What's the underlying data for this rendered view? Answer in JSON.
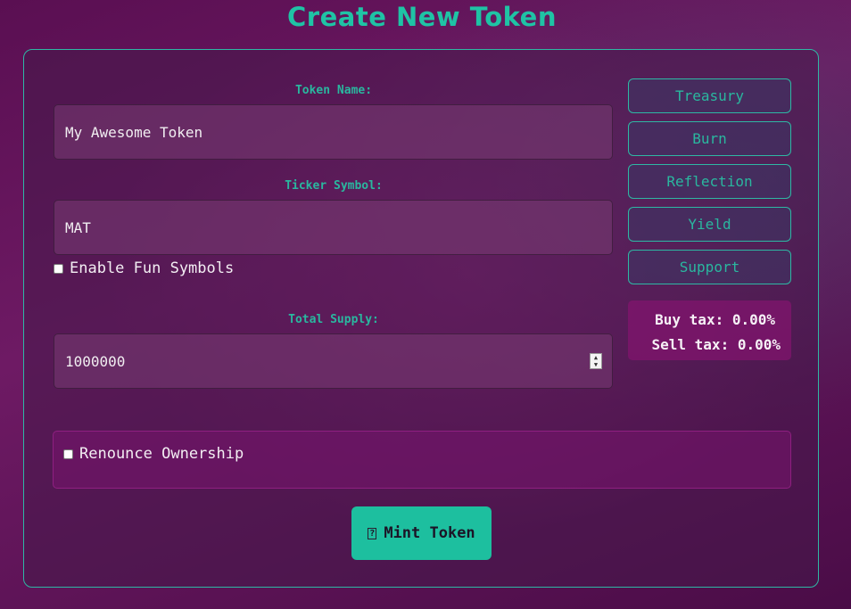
{
  "page": {
    "title": "Create New Token"
  },
  "form": {
    "token_name": {
      "label": "Token Name:",
      "value": "My Awesome Token"
    },
    "ticker": {
      "label": "Ticker Symbol:",
      "value": "MAT"
    },
    "fun_symbols": {
      "label": "Enable Fun Symbols",
      "checked": false
    },
    "total_supply": {
      "label": "Total Supply:",
      "value": "1000000"
    },
    "renounce": {
      "label": "Renounce Ownership",
      "checked": false
    }
  },
  "tax_buttons": [
    {
      "label": "Treasury"
    },
    {
      "label": "Burn"
    },
    {
      "label": "Reflection"
    },
    {
      "label": "Yield"
    },
    {
      "label": "Support"
    }
  ],
  "tax_summary": {
    "buy": "Buy tax: 0.00%",
    "sell": "Sell tax: 0.00%"
  },
  "mint_button": {
    "label": "Mint Token",
    "icon": "token-icon"
  },
  "colors": {
    "accent": "#1fc3a5",
    "background": "#5a0f52",
    "tax_box": "#82146e"
  }
}
